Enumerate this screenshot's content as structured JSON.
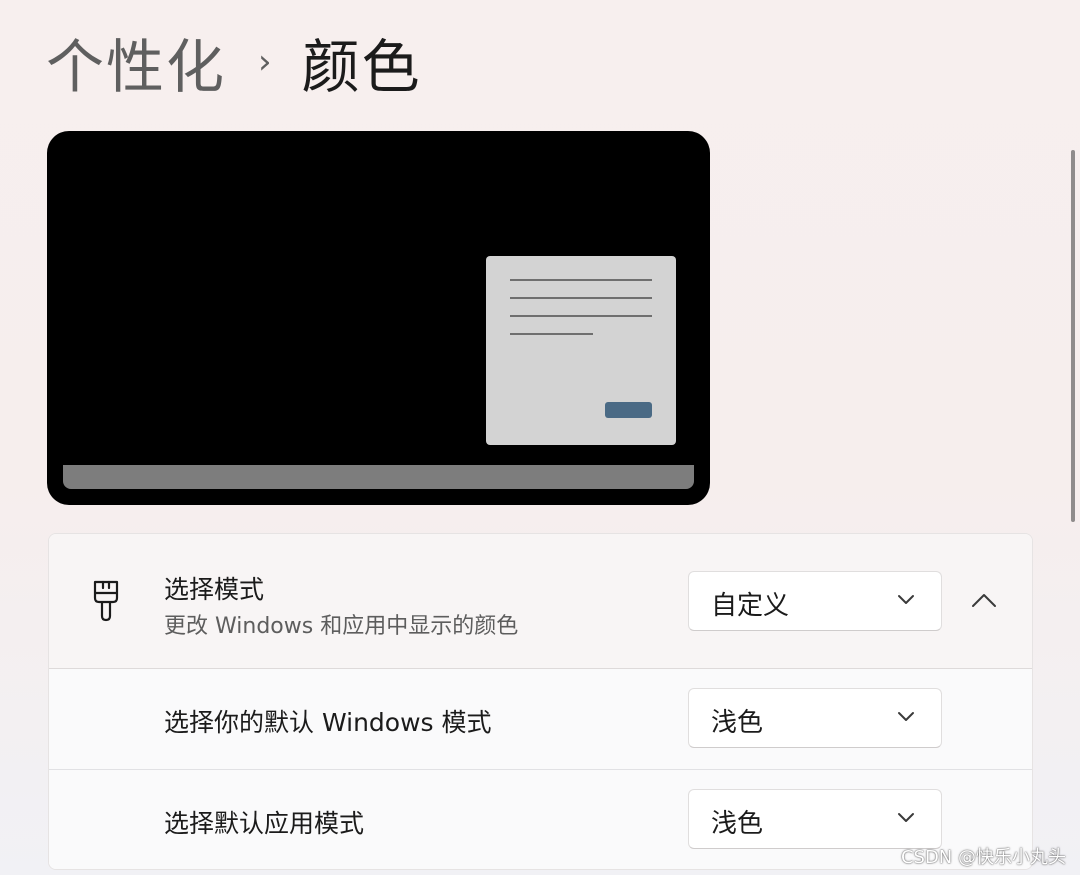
{
  "breadcrumb": {
    "parent": "个性化",
    "separator": "›",
    "current": "颜色"
  },
  "preview": {
    "desktop_color": "#000000",
    "window_color": "#d3d3d3",
    "accent_color": "#4a6a85",
    "taskbar_color": "#7d7d7d"
  },
  "mode_section": {
    "icon": "paint-brush-icon",
    "title": "选择模式",
    "subtitle": "更改 Windows 和应用中显示的颜色",
    "dropdown_value": "自定义",
    "expanded": true,
    "collapse_icon": "chevron-up-icon"
  },
  "windows_mode": {
    "label": "选择你的默认 Windows 模式",
    "dropdown_value": "浅色"
  },
  "app_mode": {
    "label": "选择默认应用模式",
    "dropdown_value": "浅色"
  },
  "watermark": "CSDN @快乐小丸头"
}
